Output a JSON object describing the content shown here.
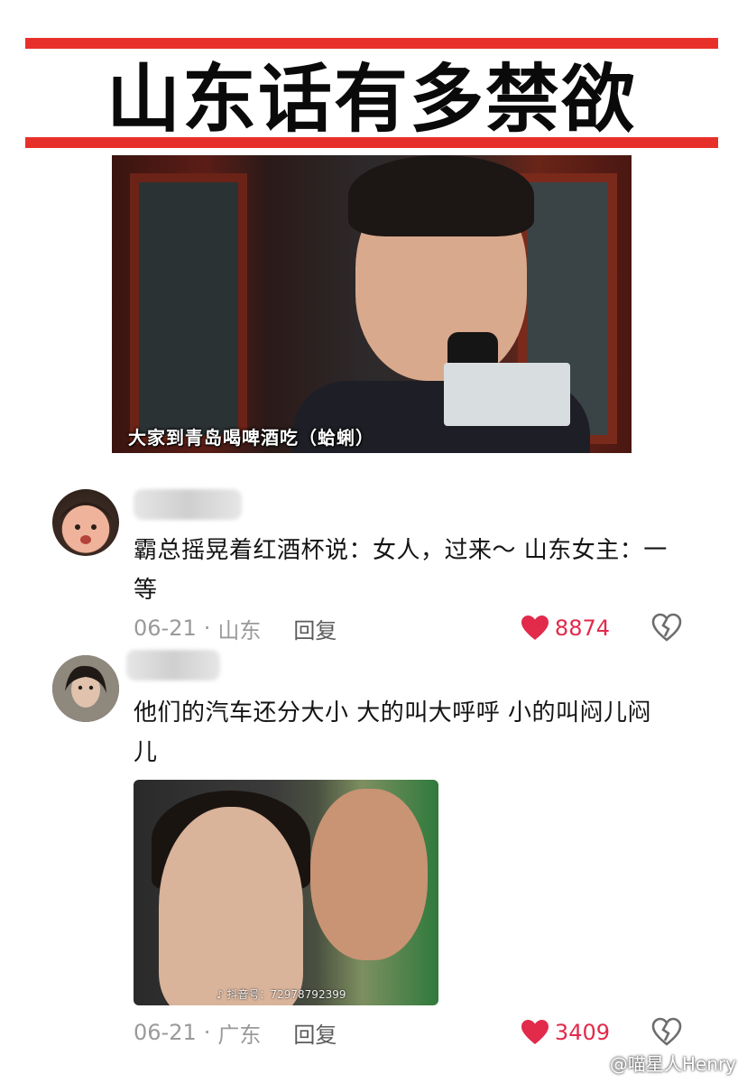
{
  "title": "山东话有多禁欲",
  "video": {
    "subtitle": "大家到青岛喝啤酒吃（蛤蜊）",
    "mic_logo": ""
  },
  "comments": [
    {
      "username": "",
      "text": "霸总摇晃着红酒杯说：女人，过来～ 山东女主：一等",
      "date": "06-21",
      "separator": "·",
      "location": "山东",
      "reply_label": "回复",
      "likes": "8874"
    },
    {
      "username": "",
      "text": "他们的汽车还分大小 大的叫大呼呼 小的叫闷儿闷儿",
      "image_watermark": "抖音号：72978792399",
      "date": "06-21",
      "separator": "·",
      "location": "广东",
      "reply_label": "回复",
      "likes": "3409"
    }
  ],
  "watermark": {
    "text": "@喵星人Henry"
  },
  "colors": {
    "title_bar": "#e8302a",
    "like": "#e22a4b",
    "meta_gray": "#9a9a9a"
  },
  "icons": {
    "like": "heart-icon",
    "dislike": "broken-heart-icon",
    "watermark": "weibo-icon",
    "image_watermark": "tiktok-icon"
  }
}
